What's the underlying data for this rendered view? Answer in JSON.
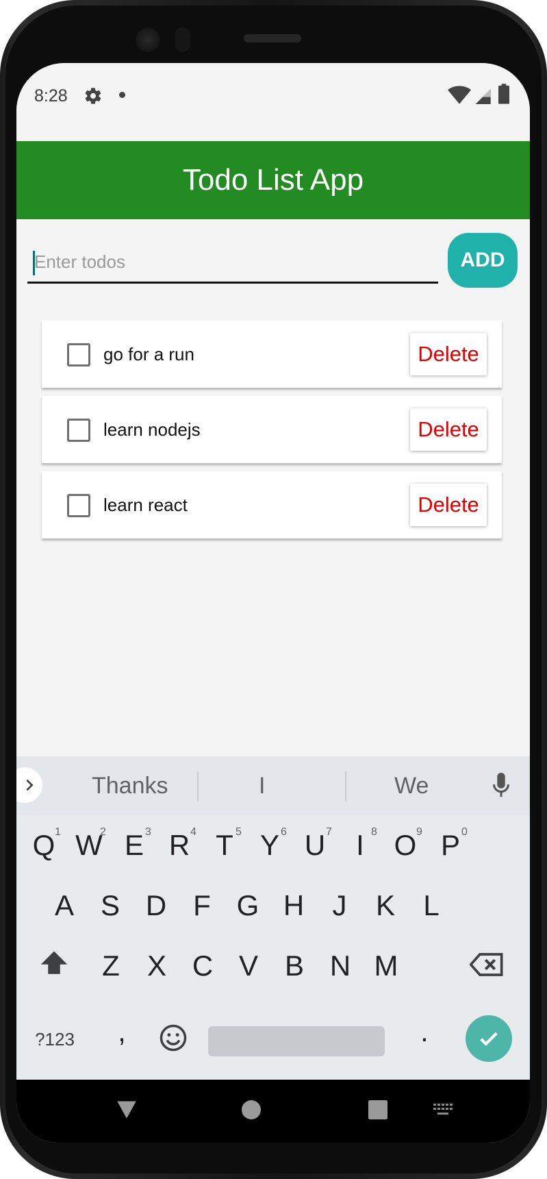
{
  "status_bar": {
    "time": "8:28",
    "icons": [
      "gear-icon",
      "dot-icon",
      "wifi-icon",
      "signal-icon",
      "battery-icon"
    ]
  },
  "header": {
    "title": "Todo List App",
    "color": "#228b22"
  },
  "input": {
    "placeholder": "Enter todos",
    "value": ""
  },
  "add_button": {
    "label": "ADD",
    "color": "#20b2aa"
  },
  "todos": [
    {
      "text": "go for a run",
      "checked": false,
      "delete_label": "Delete"
    },
    {
      "text": "learn nodejs",
      "checked": false,
      "delete_label": "Delete"
    },
    {
      "text": "learn react",
      "checked": false,
      "delete_label": "Delete"
    }
  ],
  "keyboard": {
    "suggestions": [
      "Thanks",
      "I",
      "We"
    ],
    "row1": [
      {
        "key": "Q",
        "num": "1"
      },
      {
        "key": "W",
        "num": "2"
      },
      {
        "key": "E",
        "num": "3"
      },
      {
        "key": "R",
        "num": "4"
      },
      {
        "key": "T",
        "num": "5"
      },
      {
        "key": "Y",
        "num": "6"
      },
      {
        "key": "U",
        "num": "7"
      },
      {
        "key": "I",
        "num": "8"
      },
      {
        "key": "O",
        "num": "9"
      },
      {
        "key": "P",
        "num": "0"
      }
    ],
    "row2": [
      "A",
      "S",
      "D",
      "F",
      "G",
      "H",
      "J",
      "K",
      "L"
    ],
    "row3": [
      "Z",
      "X",
      "C",
      "V",
      "B",
      "N",
      "M"
    ],
    "symbols_label": "?123",
    "comma": ",",
    "period": "."
  }
}
